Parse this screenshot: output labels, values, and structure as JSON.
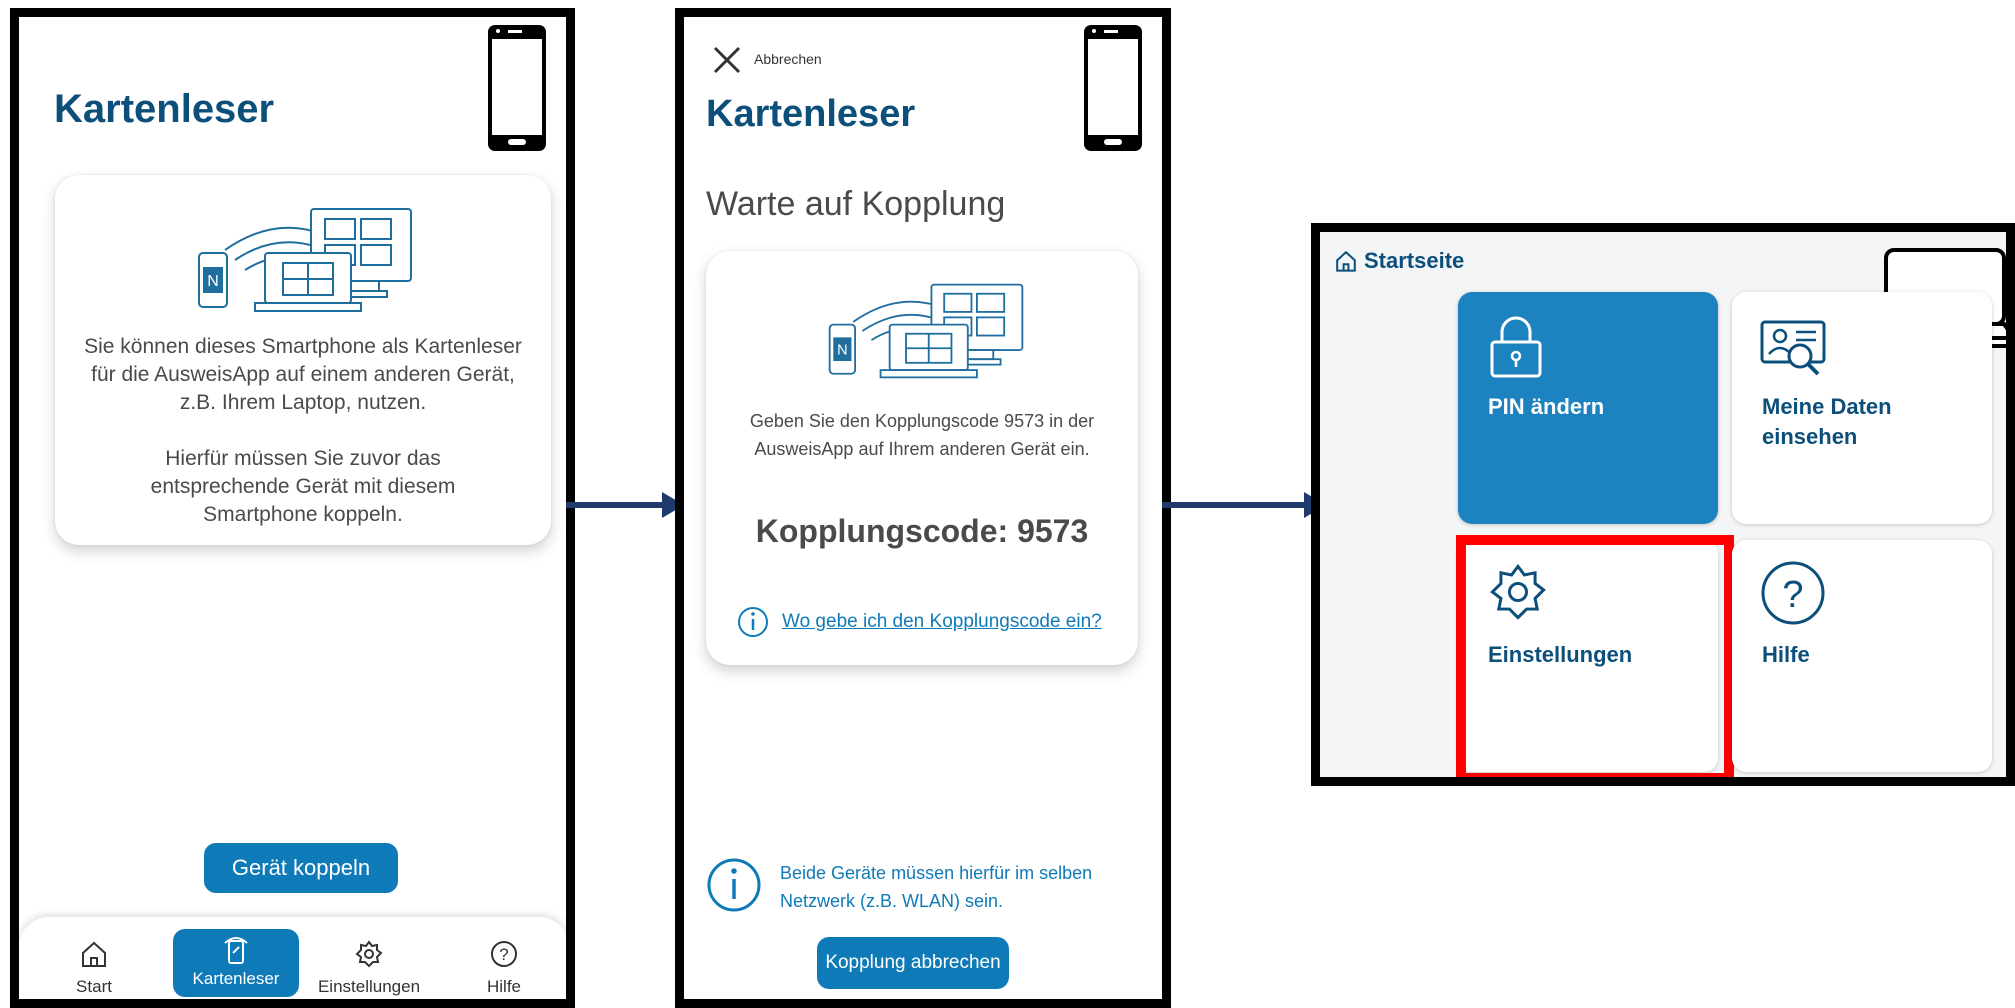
{
  "panel1": {
    "title": "Kartenleser",
    "description_1": "Sie können dieses Smartphone als Kartenleser für die AusweisApp auf einem anderen Gerät, z.B. Ihrem Laptop, nutzen.",
    "description_2": "Hierfür müssen Sie zuvor das entsprechende Gerät mit diesem Smartphone koppeln.",
    "pair_button": "Gerät koppeln",
    "nav": [
      {
        "label": "Start",
        "icon": "home-icon"
      },
      {
        "label": "Kartenleser",
        "icon": "card-reader-icon"
      },
      {
        "label": "Einstellungen",
        "icon": "gear-icon"
      },
      {
        "label": "Hilfe",
        "icon": "help-icon"
      }
    ]
  },
  "panel2": {
    "cancel_label": "Abbrechen",
    "title": "Kartenleser",
    "subtitle": "Warte auf Kopplung",
    "instruction": "Geben Sie den Kopplungscode 9573 in der AusweisApp auf Ihrem anderen Gerät ein.",
    "code_prefix": "Kopplungscode: ",
    "code_value": "9573",
    "help_link": "Wo gebe ich den Kopplungscode ein?",
    "network_hint": "Beide Geräte müssen hierfür im selben Netzwerk (z.B. WLAN) sein.",
    "abort_button": "Kopplung abbrechen"
  },
  "panel3": {
    "breadcrumb": "Startseite",
    "tiles": [
      {
        "label": "PIN ändern",
        "icon": "lock-icon"
      },
      {
        "label": "Meine Daten einsehen",
        "icon": "id-card-search-icon"
      },
      {
        "label": "Einstellungen",
        "icon": "gear-icon"
      },
      {
        "label": "Hilfe",
        "icon": "help-icon"
      }
    ]
  },
  "colors": {
    "primary_blue": "#0f7ab8",
    "title_blue": "#0b4f7a",
    "highlight_red": "#ff0000",
    "arrow": "#1f3b6d"
  }
}
